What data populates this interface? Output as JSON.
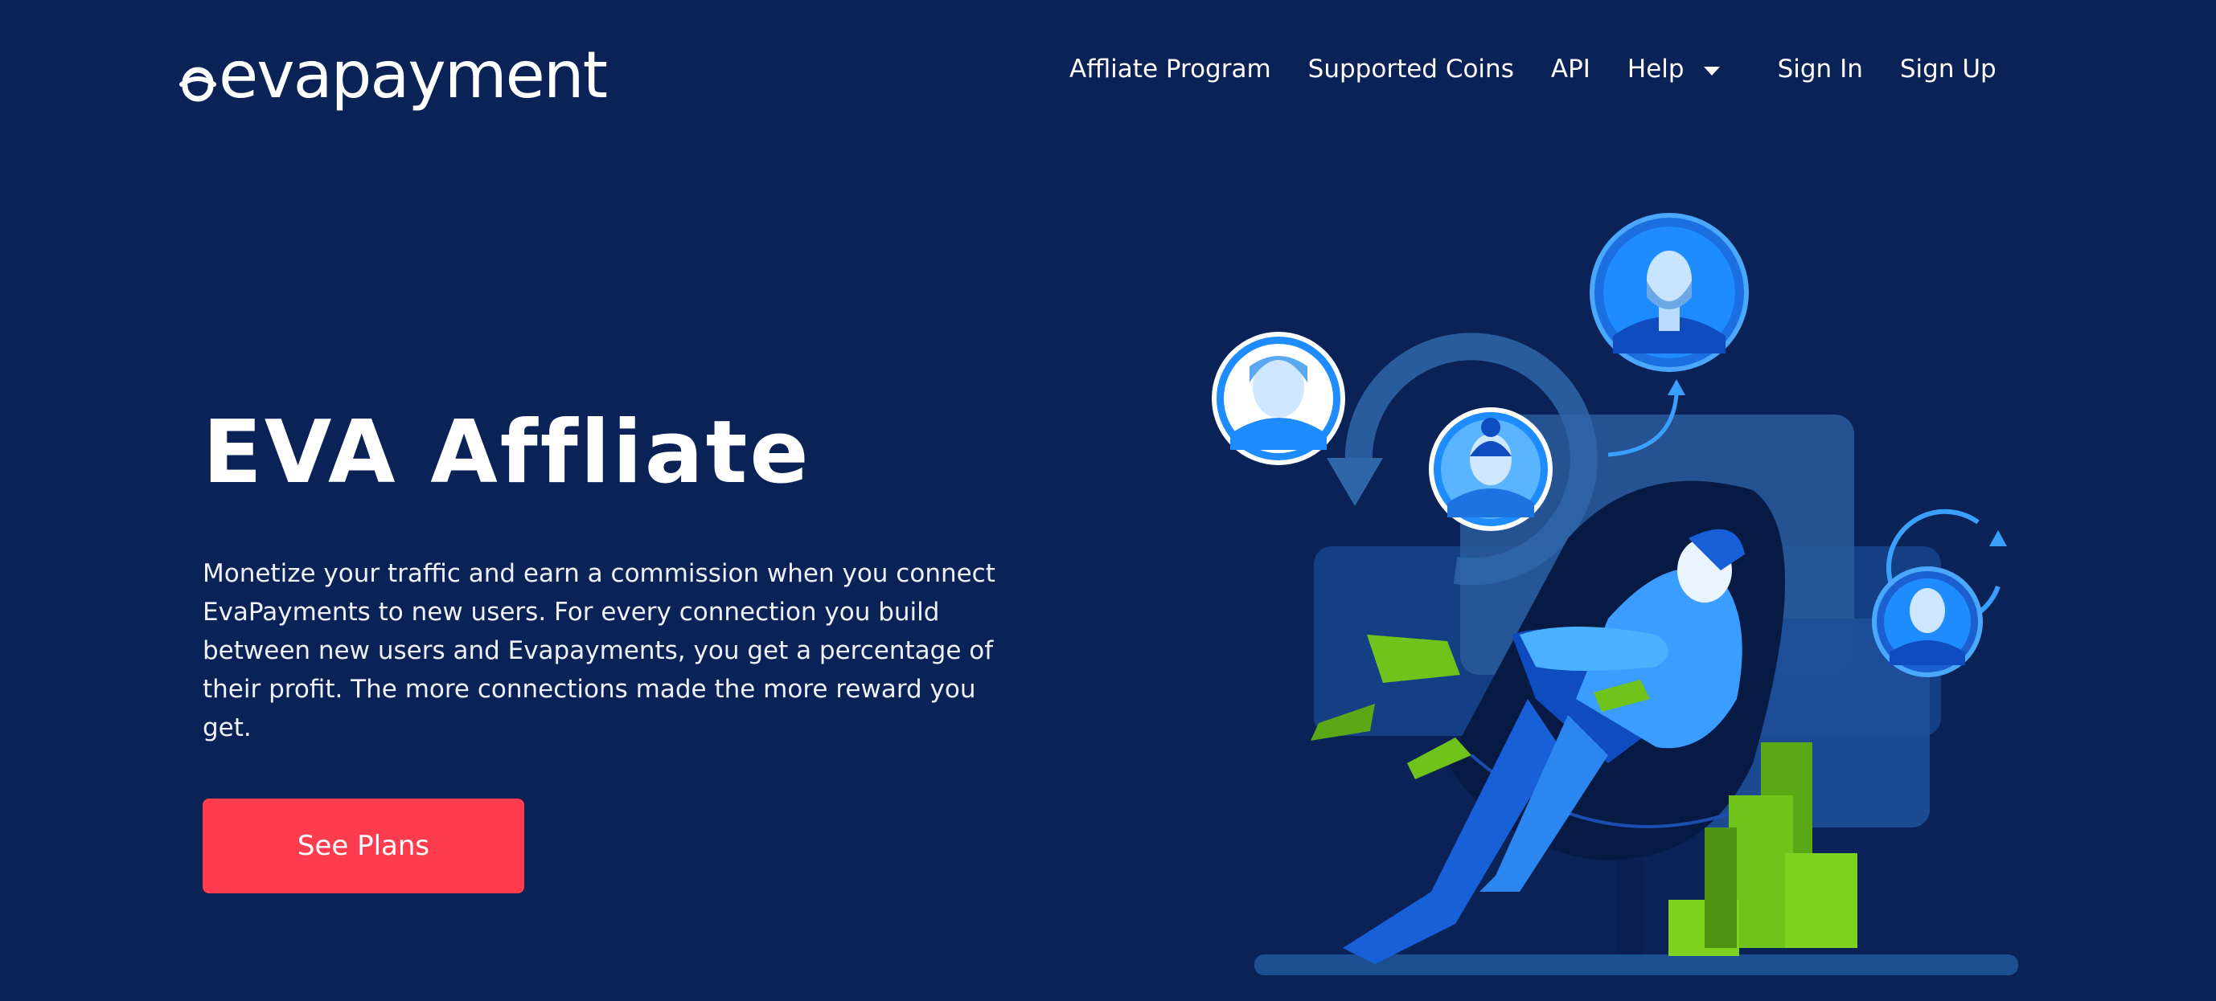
{
  "brand": {
    "name": "evapayment",
    "accent": "#ff3b4e",
    "background": "#0b2256"
  },
  "nav": {
    "items": [
      {
        "label": "Affliate Program"
      },
      {
        "label": "Supported Coins"
      },
      {
        "label": "API"
      },
      {
        "label": "Help"
      },
      {
        "label": "Sign In"
      },
      {
        "label": "Sign Up"
      }
    ],
    "help_icon": "chevron-down-icon"
  },
  "hero": {
    "title": "EVA Affliate",
    "description": "Monetize your traffic and earn a commission when you connect EvaPayments to new users. For every connection you build between new users and Evapayments, you get a percentage of their profit. The more connections made the more reward you get.",
    "cta_label": "See Plans"
  },
  "illustration": {
    "subject": "relaxed man in armchair surrounded by user avatars and money stacks",
    "icons": [
      "user-avatar-icon",
      "cycle-arrow-icon",
      "money-bill-icon",
      "money-stack-icon"
    ]
  }
}
